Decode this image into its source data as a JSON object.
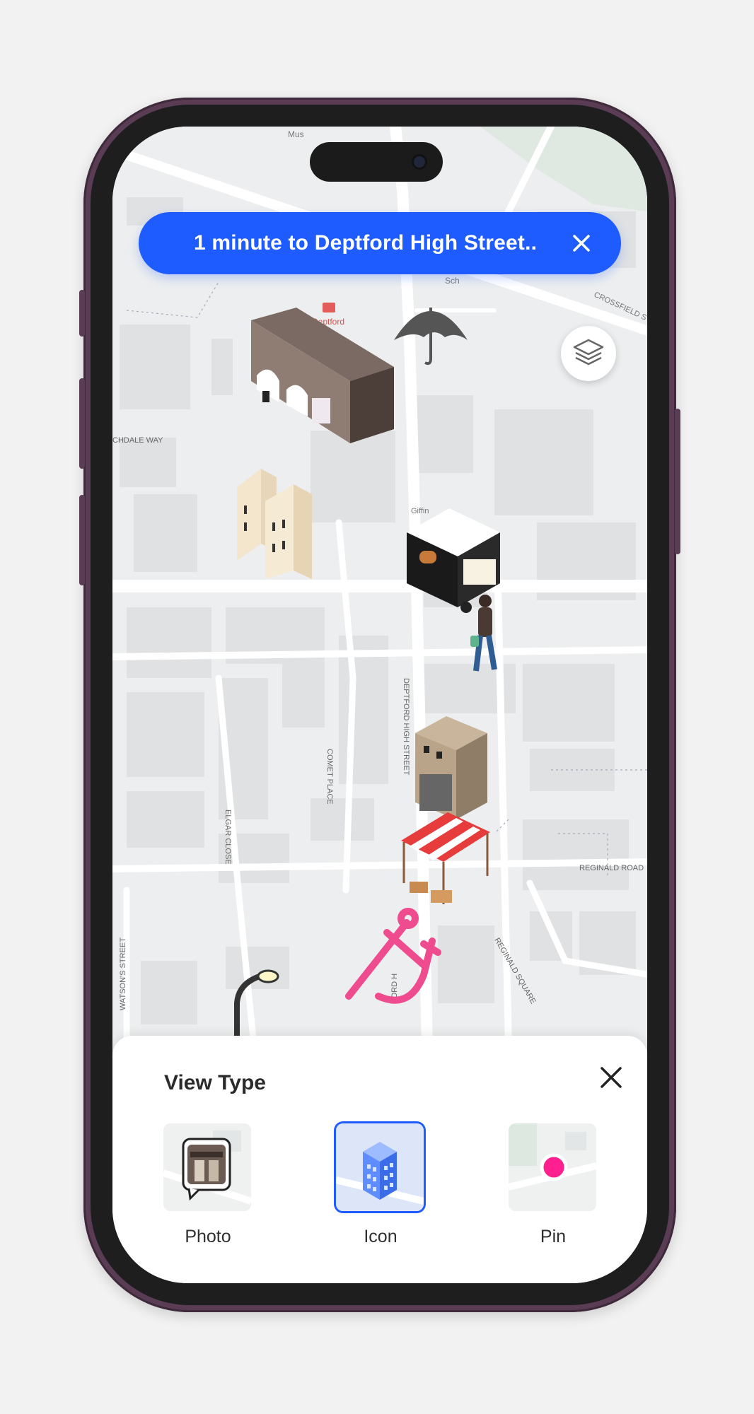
{
  "banner": {
    "text": "1 minute to Deptford High Street.."
  },
  "map": {
    "street_labels": [
      "Mus",
      "Deptford",
      "Sch",
      "CROSSFIELD ST",
      "CHDALE WAY",
      "Giffin",
      "DEPTFORD HIGH STREET",
      "COMET PLACE",
      "ELGAR CLOSE",
      "REGINALD ROAD",
      "REGINALD SQUARE",
      "WATSON'S STREET",
      "FORD H"
    ],
    "icons": [
      "station-building-icon",
      "umbrella-icon",
      "apartment-blocks-icon",
      "food-truck-icon",
      "pedestrian-icon",
      "house-icon",
      "market-stall-icon",
      "anchor-icon",
      "street-lamp-icon"
    ]
  },
  "sheet": {
    "title": "View Type",
    "options": [
      {
        "label": "Photo",
        "icon": "photo-icon",
        "selected": false
      },
      {
        "label": "Icon",
        "icon": "building-icon",
        "selected": true
      },
      {
        "label": "Pin",
        "icon": "pin-icon",
        "selected": false
      }
    ]
  },
  "colors": {
    "accent": "#1e5cff",
    "pin": "#ff1f8e",
    "frame": "#5a3d55"
  }
}
